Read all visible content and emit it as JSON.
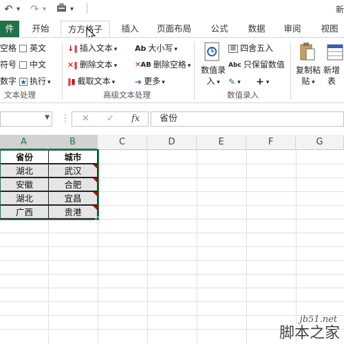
{
  "window": {
    "title": "新"
  },
  "tabs": [
    "件",
    "开始",
    "方方格子",
    "插入",
    "页面布局",
    "公式",
    "数据",
    "审阅",
    "视图"
  ],
  "ribbon": {
    "text_group": {
      "items": [
        "空格",
        "英文",
        "符号",
        "中文",
        "数字",
        "执行"
      ],
      "label": "文本处理"
    },
    "advanced_group": {
      "insert_text": "插入文本",
      "delete_text": "删除文本",
      "extract_text": "截取文本",
      "case": "大小写",
      "delete_space": "删除空格",
      "more": "更多",
      "label": "高级文本处理"
    },
    "value_group": {
      "value_entry_1": "数值录",
      "value_entry_2": "入",
      "round": "四舍五入",
      "keep_value": "只保留数值",
      "label": "数值录入"
    },
    "paste_group": {
      "copy_paste_1": "复制粘",
      "copy_paste_2": "贴",
      "new_1": "新增",
      "new_2": "表"
    }
  },
  "formula_bar": {
    "fx": "fx",
    "value": "省份"
  },
  "columns": [
    "A",
    "B",
    "C",
    "D",
    "E",
    "F",
    "G"
  ],
  "table": {
    "headers": [
      "省份",
      "城市"
    ],
    "rows": [
      [
        "湖北",
        "武汉"
      ],
      [
        "安徽",
        "合肥"
      ],
      [
        "湖北",
        "宜昌"
      ],
      [
        "广西",
        "贵港"
      ]
    ]
  },
  "watermark": {
    "line1": "jb51.net",
    "line2": "脚本之家"
  },
  "colors": {
    "accent": "#217346",
    "comment_flag": "#cc0000",
    "cursor": "#e02020"
  }
}
